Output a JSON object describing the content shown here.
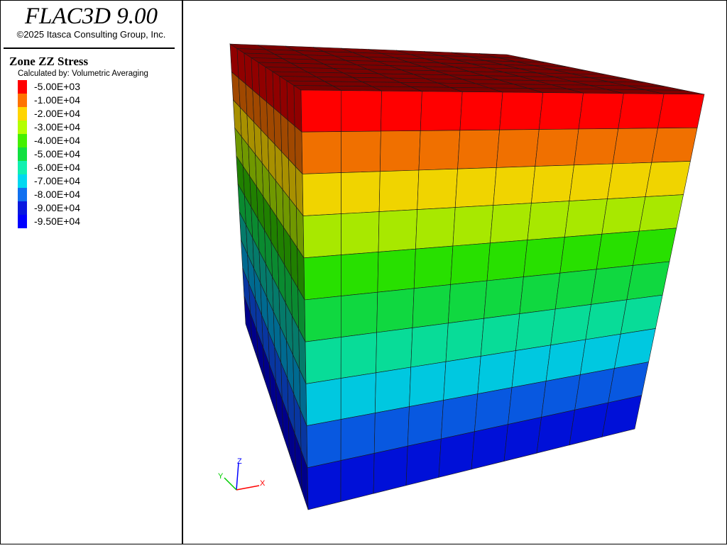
{
  "header": {
    "app_title": "FLAC3D 9.00",
    "copyright": "©2025 Itasca Consulting Group, Inc."
  },
  "legend": {
    "title": "Zone ZZ Stress",
    "subtitle": "Calculated by: Volumetric Averaging",
    "items": [
      {
        "label": "-5.00E+03",
        "color": "#ff0000"
      },
      {
        "label": "-1.00E+04",
        "color": "#ff7300"
      },
      {
        "label": "-2.00E+04",
        "color": "#ffd500"
      },
      {
        "label": "-3.00E+04",
        "color": "#b4ff00"
      },
      {
        "label": "-4.00E+04",
        "color": "#44f000"
      },
      {
        "label": "-5.00E+04",
        "color": "#10e040"
      },
      {
        "label": "-6.00E+04",
        "color": "#10f0b0"
      },
      {
        "label": "-7.00E+04",
        "color": "#00d8f0"
      },
      {
        "label": "-8.00E+04",
        "color": "#1070f0"
      },
      {
        "label": "-9.00E+04",
        "color": "#0818e0"
      },
      {
        "label": "-9.50E+04",
        "color": "#0000ff"
      }
    ]
  },
  "model": {
    "front_band_colors": [
      "#ff0000",
      "#f07000",
      "#f0d400",
      "#a8e800",
      "#28e000",
      "#10d840",
      "#08dc98",
      "#00c8e0",
      "#0858e0",
      "#0010d8"
    ],
    "side_band_colors": [
      "#900000",
      "#a04800",
      "#a89000",
      "#709800",
      "#208000",
      "#0a8a30",
      "#057a6a",
      "#006a90",
      "#0836a0",
      "#00008a"
    ],
    "top_color": "#7a0000",
    "grid_divisions": 10
  },
  "axes_triad": {
    "x_label": "X",
    "y_label": "Y",
    "z_label": "Z",
    "x_color": "#ff0000",
    "y_color": "#00cc00",
    "z_color": "#0000ff"
  }
}
